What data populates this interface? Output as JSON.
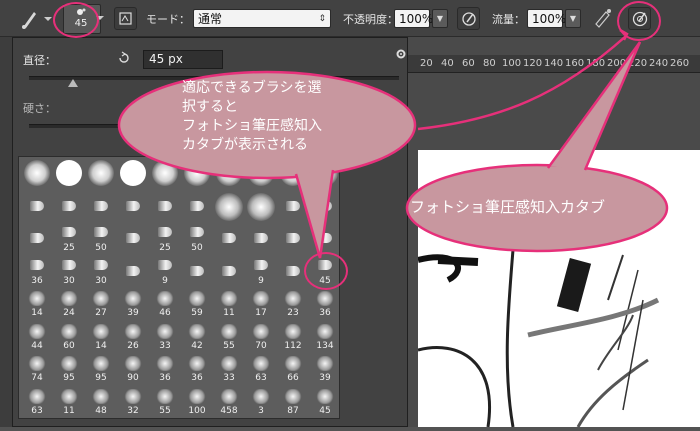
{
  "toolbar": {
    "brush_size": "45",
    "mode_label": "モード：",
    "mode_value": "通常",
    "opacity_label": "不透明度：",
    "opacity_value": "100%",
    "flow_label": "流量：",
    "flow_value": "100%"
  },
  "brush_panel": {
    "diameter_label": "直径：",
    "diameter_value": "45 px",
    "hardness_label": "硬さ：",
    "diameter_level": 0.12,
    "brush_rows": [
      [
        "",
        "",
        "",
        "",
        "",
        "",
        "",
        "",
        "",
        ""
      ],
      [
        "",
        "",
        "",
        "",
        "",
        "",
        "",
        "",
        "",
        ""
      ],
      [
        "",
        "25",
        "50",
        "",
        "25",
        "50",
        "",
        "",
        "",
        ""
      ],
      [
        "36",
        "30",
        "30",
        "",
        "9",
        "",
        "",
        "9",
        "",
        "45"
      ],
      [
        "14",
        "24",
        "27",
        "39",
        "46",
        "59",
        "11",
        "17",
        "23",
        "36"
      ],
      [
        "44",
        "60",
        "14",
        "26",
        "33",
        "42",
        "55",
        "70",
        "112",
        "134"
      ],
      [
        "74",
        "95",
        "95",
        "90",
        "36",
        "36",
        "33",
        "63",
        "66",
        "39"
      ],
      [
        "63",
        "11",
        "48",
        "32",
        "55",
        "100",
        "458",
        "3",
        "87",
        "45"
      ]
    ]
  },
  "ruler": {
    "ticks": [
      "20",
      "40",
      "60",
      "80",
      "100",
      "120",
      "140",
      "160",
      "180",
      "200",
      "220",
      "240",
      "260"
    ]
  },
  "annotations": {
    "callout_left_lines": [
      "適応できるブラシを選",
      "択すると",
      "フォトショ筆圧感知入",
      "カタブが表示される"
    ],
    "callout_right": "フォトショ筆圧感知入カタブ"
  },
  "colors": {
    "accent": "#e6307a",
    "bubble_fill": "#c8979f",
    "panel_bg": "#424242"
  }
}
